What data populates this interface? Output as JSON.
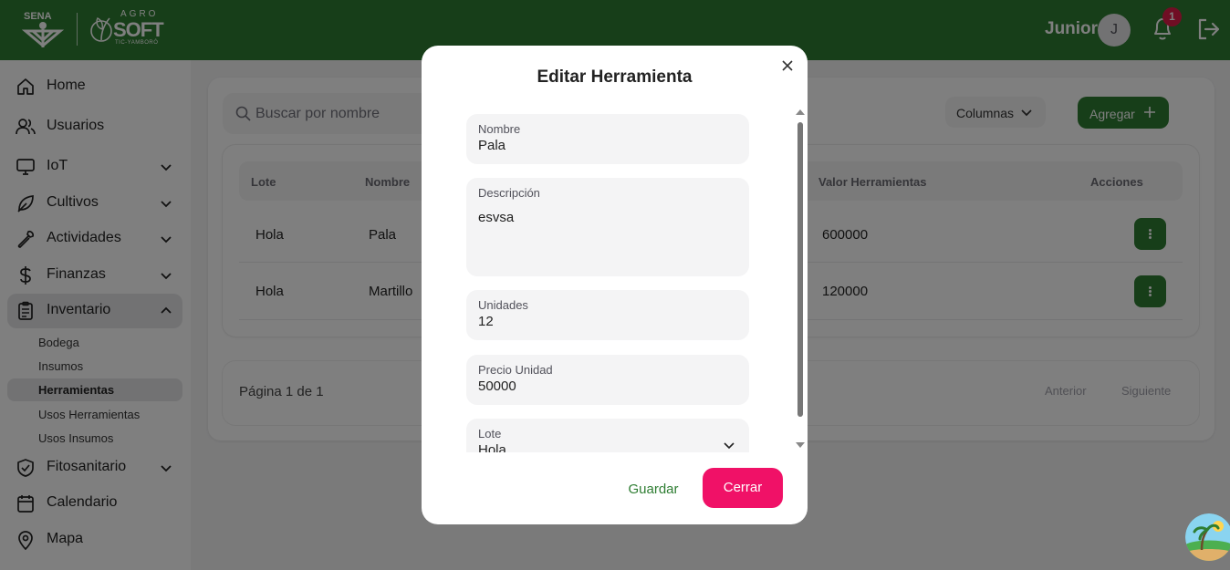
{
  "header": {
    "brand_sena": "SENA",
    "brand_top": "AGRO",
    "brand_main": "SOFT",
    "brand_sub": "TIC-YAMBORÓ",
    "user_name": "Junior",
    "avatar_initial": "J",
    "notification_count": "1",
    "color": "#2e7d32"
  },
  "sidebar": {
    "items": [
      {
        "label": "Home",
        "icon": "home-icon"
      },
      {
        "label": "Usuarios",
        "icon": "users-icon"
      },
      {
        "label": "IoT",
        "icon": "monitor-icon"
      },
      {
        "label": "Cultivos",
        "icon": "leaf-icon"
      },
      {
        "label": "Actividades",
        "icon": "wrench-icon"
      },
      {
        "label": "Finanzas",
        "icon": "dollar-icon"
      },
      {
        "label": "Inventario",
        "icon": "clipboard-icon"
      },
      {
        "label": "Fitosanitario",
        "icon": "shield-check-icon"
      },
      {
        "label": "Calendario",
        "icon": "calendar-icon"
      },
      {
        "label": "Mapa",
        "icon": "map-pin-icon"
      }
    ],
    "inventory_sub": [
      {
        "label": "Bodega"
      },
      {
        "label": "Insumos"
      },
      {
        "label": "Herramientas"
      },
      {
        "label": "Usos Herramientas"
      },
      {
        "label": "Usos Insumos"
      }
    ]
  },
  "main": {
    "search_placeholder": "Buscar por nombre",
    "columns_button": "Columnas",
    "add_button": "Agregar",
    "table": {
      "headers": [
        "Lote",
        "Nombre",
        "Valor Herramientas",
        "Acciones"
      ],
      "rows": [
        {
          "lote": "Hola",
          "nombre": "Pala",
          "valor": "600000"
        },
        {
          "lote": "Hola",
          "nombre": "Martillo",
          "valor": "120000"
        }
      ]
    },
    "pagination": {
      "text": "Página 1 de 1",
      "prev": "Anterior",
      "next": "Siguiente"
    }
  },
  "modal": {
    "title": "Editar Herramienta",
    "fields": {
      "nombre": {
        "label": "Nombre",
        "value": "Pala"
      },
      "descripcion": {
        "label": "Descripción",
        "value": "esvsa"
      },
      "unidades": {
        "label": "Unidades",
        "value": "12"
      },
      "precio": {
        "label": "Precio Unidad",
        "value": "50000"
      },
      "lote": {
        "label": "Lote",
        "value": "Hola"
      }
    },
    "save_button": "Guardar",
    "close_button": "Cerrar",
    "accent": "#f01167"
  }
}
